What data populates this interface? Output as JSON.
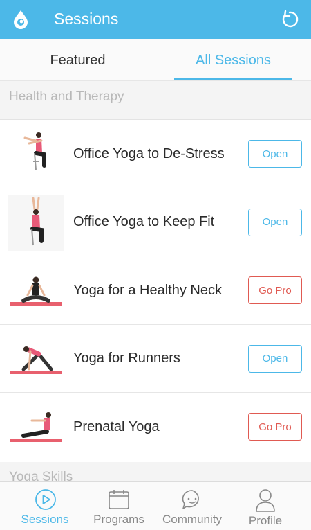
{
  "header": {
    "title": "Sessions",
    "logo_icon": "drop-logo-icon",
    "refresh_icon": "refresh-icon",
    "color": "#4cb8e8"
  },
  "tabs": [
    {
      "label": "Featured",
      "active": false
    },
    {
      "label": "All Sessions",
      "active": true
    }
  ],
  "sections": [
    {
      "title": "Health and Therapy",
      "items": [
        {
          "name": "Office Yoga to De-Stress",
          "action": "Open",
          "type": "open"
        },
        {
          "name": "Office Yoga to Keep Fit",
          "action": "Open",
          "type": "open"
        },
        {
          "name": "Yoga for a Healthy Neck",
          "action": "Go Pro",
          "type": "pro"
        },
        {
          "name": "Yoga for Runners",
          "action": "Open",
          "type": "open"
        },
        {
          "name": "Prenatal Yoga",
          "action": "Go Pro",
          "type": "pro"
        }
      ]
    },
    {
      "title": "Yoga Skills"
    }
  ],
  "bottom_nav": [
    {
      "label": "Sessions",
      "icon": "play-circle-icon",
      "active": true
    },
    {
      "label": "Programs",
      "icon": "calendar-icon",
      "active": false
    },
    {
      "label": "Community",
      "icon": "chat-bubble-icon",
      "active": false
    },
    {
      "label": "Profile",
      "icon": "person-icon",
      "active": false
    }
  ]
}
